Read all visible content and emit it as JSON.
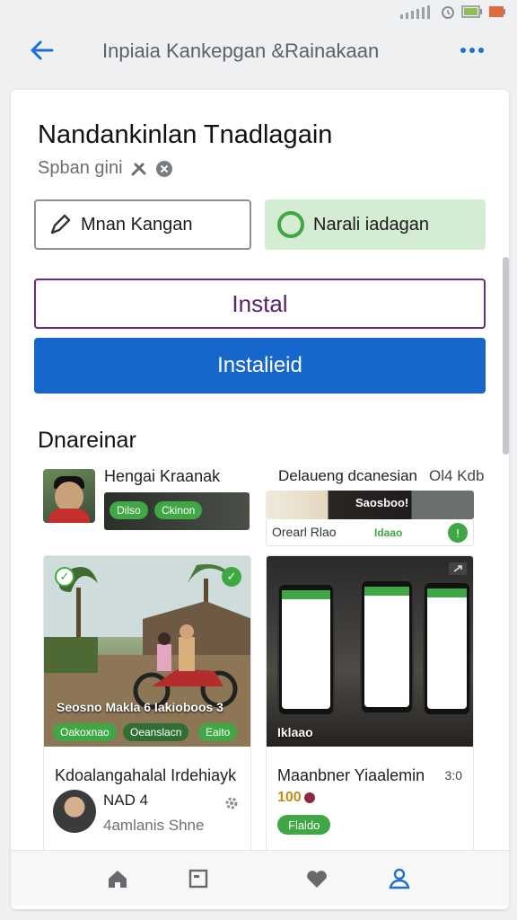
{
  "status_bar": {
    "icons": [
      "signal-icon",
      "alarm-icon",
      "battery-icon",
      "notification-icon"
    ]
  },
  "header": {
    "title": "Inpiaia Kankepgan &Rainakaan"
  },
  "app": {
    "name": "Nandankinlan Tnadlagain",
    "subtitle": "Spban gini"
  },
  "actions": {
    "outline_button_label": "Mnan Kangan",
    "green_button_label": "Narali iadagan",
    "install_label": "Instal",
    "installed_label": "Instalieid"
  },
  "section": {
    "title": "Dnareinar"
  },
  "mini_cards": [
    {
      "title": "Hengai Kraanak",
      "chips": [
        "Dilso",
        "Ckinon"
      ]
    },
    {
      "title": "Delaueng dcanesian",
      "meta": "Ol4 Kdb",
      "image_label": "Saosboo!",
      "row_label": "Orearl Rlao",
      "row_center": "Idaao"
    }
  ],
  "big_cards": [
    {
      "caption": "Seosno Makla 6 Iakioboos 3",
      "chips": [
        "Oakoxnao",
        "Oeanslacn",
        "Eaito"
      ],
      "title": "Kdoalangahalal Irdehiayk",
      "author": "NAD 4",
      "subtext": "4amlanis Shne"
    },
    {
      "overlay_label": "Iklaao",
      "title": "Maanbner Yiaalemin",
      "meta": "3:0",
      "rating": "100",
      "tag": "Flaldo"
    }
  ],
  "nav": {
    "items": [
      "home-icon",
      "calendar-icon",
      "heart-icon",
      "profile-icon"
    ]
  },
  "colors": {
    "primary_blue": "#1766cc",
    "install_purple": "#6b2a7b",
    "accent_green": "#3fa844",
    "green_button_bg": "#d4ecd1"
  }
}
